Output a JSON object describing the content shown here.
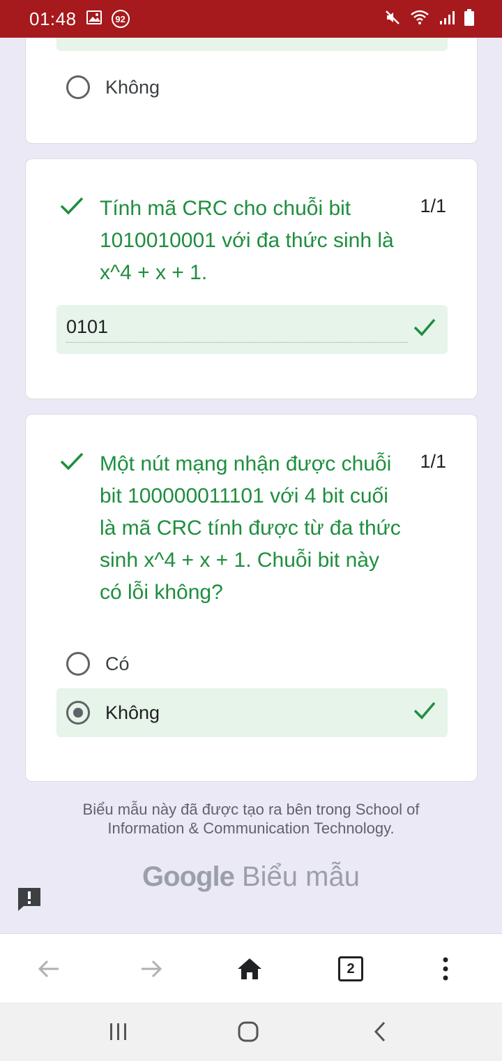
{
  "status_bar": {
    "time": "01:48",
    "notification_count": "92",
    "icons": [
      "image-icon",
      "notification-badge-icon",
      "mute-icon",
      "wifi-icon",
      "signal-icon",
      "battery-icon"
    ]
  },
  "colors": {
    "status_bar": "#a6191c",
    "page_background": "#ece9f6",
    "correct_green": "#1e8e3e",
    "correct_bg": "#e6f4ea"
  },
  "question_prev": {
    "option_label": "Không"
  },
  "question_crc_calc": {
    "title": "Tính mã CRC cho chuỗi bit 1010010001 với đa thức sinh là x^4 + x + 1.",
    "score": "1/1",
    "answer": "0101"
  },
  "question_crc_check": {
    "title": "Một nút mạng nhận được chuỗi bit 100000011101 với 4 bit cuối là mã CRC tính được từ đa thức sinh x^4 + x + 1. Chuỗi bit này có lỗi không?",
    "score": "1/1",
    "options": [
      "Có",
      "Không"
    ],
    "selected": "Không"
  },
  "footer": {
    "line1": "Biểu mẫu này đã được tạo ra bên trong School of",
    "line2": "Information & Communication Technology.",
    "brand_google": "Google",
    "brand_product": "Biểu mẫu"
  },
  "browser_toolbar": {
    "tab_count": "2",
    "icons": [
      "back-arrow-icon",
      "forward-arrow-icon",
      "home-icon",
      "tabs-icon",
      "more-menu-icon"
    ]
  },
  "system_nav": {
    "icons": [
      "recent-apps-icon",
      "home-circle-icon",
      "back-chevron-icon"
    ]
  }
}
